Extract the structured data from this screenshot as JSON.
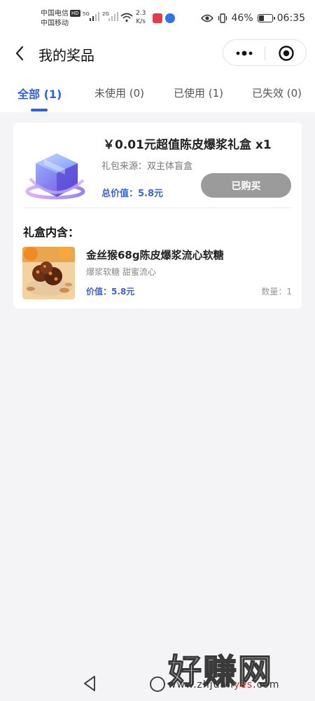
{
  "status_bar": {
    "carrier1": "中国电信",
    "carrier1_badge": "HD",
    "carrier2": "中国移动",
    "net1": "5G",
    "net2": "2G",
    "speed_value": "2.3",
    "speed_unit": "K/s",
    "battery_percent": "46%",
    "battery_level": 0.46,
    "time": "06:35"
  },
  "header": {
    "title": "我的奖品"
  },
  "tabs": [
    {
      "label": "全部 (1)",
      "active": true
    },
    {
      "label": "未使用 (0)",
      "active": false
    },
    {
      "label": "已使用 (1)",
      "active": false
    },
    {
      "label": "已失效 (0)",
      "active": false
    }
  ],
  "prize": {
    "title": "￥0.01元超值陈皮爆浆礼盒 x1",
    "source": "礼包来源：双主体盲盒",
    "total_value": "总价值：5.8元",
    "status_button": "已购买",
    "contains_heading": "礼盒内含：",
    "item": {
      "name": "金丝猴68g陈皮爆浆流心软糖",
      "desc": "爆浆软糖 甜蜜流心",
      "price": "价值：5.8元",
      "quantity": "数量：1"
    }
  },
  "watermark": {
    "text": "好赚网",
    "url_prefix": "www.zhjuan",
    "url_highlight": "yes",
    "url_suffix": ".com"
  },
  "colors": {
    "accent": "#2f5fe3",
    "price_blue": "#3a63d6",
    "button_gray": "#9b9b9b",
    "page_bg": "#f4f4f6"
  }
}
